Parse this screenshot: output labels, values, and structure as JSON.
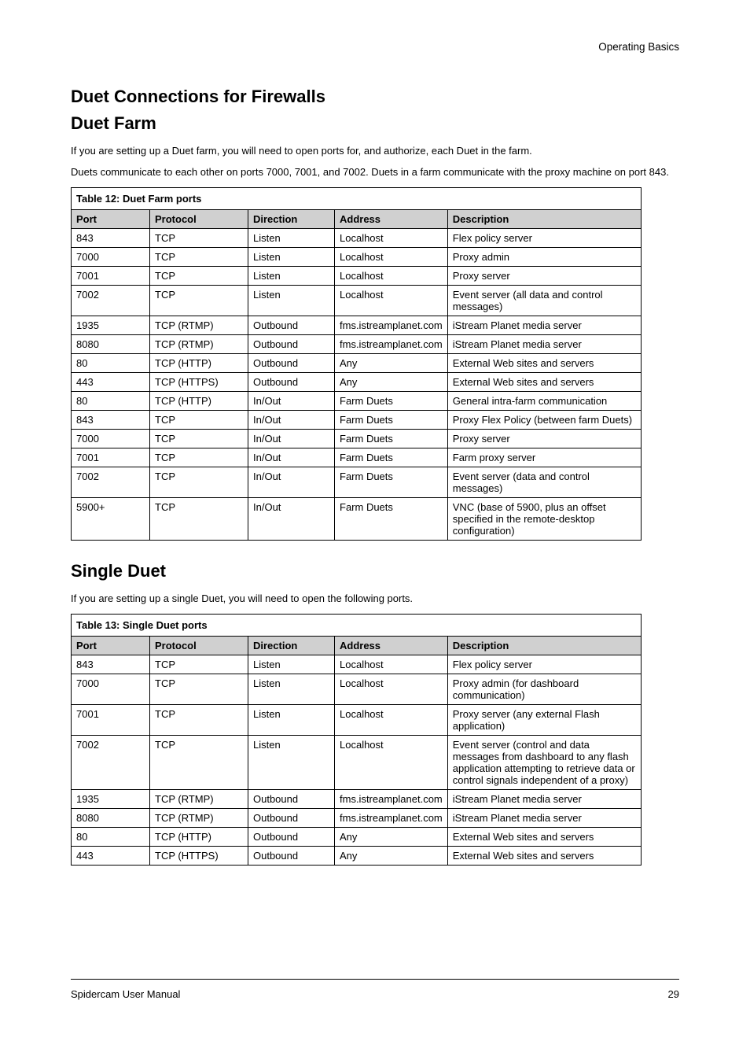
{
  "header": {
    "right": "Operating Basics"
  },
  "intro": {
    "title": "Duet Connections for Firewalls",
    "subtitle": "Duet Farm",
    "para1": "If you are setting up a Duet farm, you will need to open ports for, and authorize, each Duet in the farm.",
    "para2": "Duets communicate to each other on ports 7000, 7001, and 7002. Duets in a farm communicate with the proxy machine on port 843."
  },
  "table1": {
    "caption": "Table 12: Duet Farm ports",
    "headers": [
      "Port",
      "Protocol",
      "Direction",
      "Address",
      "Description"
    ],
    "rows": [
      [
        "843",
        "TCP",
        "Listen",
        "Localhost",
        "Flex policy server"
      ],
      [
        "7000",
        "TCP",
        "Listen",
        "Localhost",
        "Proxy admin"
      ],
      [
        "7001",
        "TCP",
        "Listen",
        "Localhost",
        "Proxy server"
      ],
      [
        "7002",
        "TCP",
        "Listen",
        "Localhost",
        "Event server (all data and control messages)"
      ],
      [
        "1935",
        "TCP (RTMP)",
        "Outbound",
        "fms.istreamplanet.com",
        "iStream Planet media server"
      ],
      [
        "8080",
        "TCP (RTMP)",
        "Outbound",
        "fms.istreamplanet.com",
        "iStream Planet media server"
      ],
      [
        "80",
        "TCP (HTTP)",
        "Outbound",
        "Any",
        "External Web sites and servers"
      ],
      [
        "443",
        "TCP (HTTPS)",
        "Outbound",
        "Any",
        "External Web sites and servers"
      ],
      [
        "80",
        "TCP (HTTP)",
        "In/Out",
        "Farm Duets",
        "General intra-farm communication"
      ],
      [
        "843",
        "TCP",
        "In/Out",
        "Farm Duets",
        "Proxy Flex Policy (between farm Duets)"
      ],
      [
        "7000",
        "TCP",
        "In/Out",
        "Farm Duets",
        "Proxy server"
      ],
      [
        "7001",
        "TCP",
        "In/Out",
        "Farm Duets",
        "Farm proxy server"
      ],
      [
        "7002",
        "TCP",
        "In/Out",
        "Farm Duets",
        "Event server (data and control messages)"
      ],
      [
        "5900+",
        "TCP",
        "In/Out",
        "Farm Duets",
        "VNC (base of 5900, plus an offset specified in the remote-desktop configuration)"
      ]
    ]
  },
  "single": {
    "title": "Single Duet",
    "para": "If you are setting up a single Duet, you will need to open the following ports."
  },
  "table2": {
    "caption": "Table 13: Single Duet ports",
    "headers": [
      "Port",
      "Protocol",
      "Direction",
      "Address",
      "Description"
    ],
    "rows": [
      [
        "843",
        "TCP",
        "Listen",
        "Localhost",
        "Flex policy server"
      ],
      [
        "7000",
        "TCP",
        "Listen",
        "Localhost",
        "Proxy admin (for dashboard communication)"
      ],
      [
        "7001",
        "TCP",
        "Listen",
        "Localhost",
        "Proxy server (any external Flash application)"
      ],
      [
        "7002",
        "TCP",
        "Listen",
        "Localhost",
        "Event server (control and data messages from dashboard to any flash application attempting to retrieve data or control signals independent of a proxy)"
      ],
      [
        "1935",
        "TCP (RTMP)",
        "Outbound",
        "fms.istreamplanet.com",
        "iStream Planet media server"
      ],
      [
        "8080",
        "TCP (RTMP)",
        "Outbound",
        "fms.istreamplanet.com",
        "iStream Planet media server"
      ],
      [
        "80",
        "TCP (HTTP)",
        "Outbound",
        "Any",
        "External Web sites and servers"
      ],
      [
        "443",
        "TCP (HTTPS)",
        "Outbound",
        "Any",
        "External Web sites and servers"
      ]
    ]
  },
  "footer": {
    "left": "Spidercam User Manual",
    "right": "29"
  }
}
